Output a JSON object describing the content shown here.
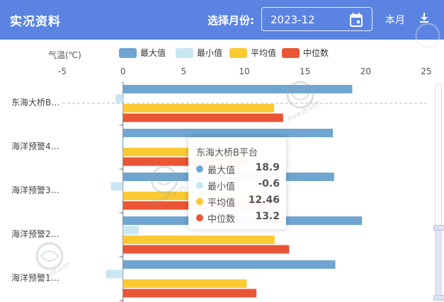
{
  "header": {
    "title": "实况资料",
    "month_label": "选择月份:",
    "month_value": "2023-12",
    "view_button": "本月"
  },
  "icons": {
    "calendar": "calendar-icon",
    "download": "download-icon"
  },
  "watermark_text": "ReadEarth",
  "chart_data": {
    "type": "bar",
    "orientation": "horizontal",
    "ylabel": "气温(℃)",
    "xlim": [
      -5,
      25
    ],
    "ticks": [
      -5,
      0,
      5,
      10,
      15,
      20,
      25
    ],
    "categories": [
      "东海大桥B…",
      "海洋预警4…",
      "海洋预警3…",
      "海洋预警2…",
      "海洋预警1…"
    ],
    "series": [
      {
        "name": "最大值",
        "color": "#6fa5d0",
        "values": [
          18.9,
          17.3,
          17.4,
          19.7,
          17.5
        ]
      },
      {
        "name": "最小值",
        "color": "#c8e7f3",
        "values": [
          -0.6,
          -0.1,
          -1.0,
          1.3,
          -1.4
        ]
      },
      {
        "name": "平均值",
        "color": "#fbc932",
        "values": [
          12.46,
          10.5,
          11.8,
          12.5,
          10.2
        ]
      },
      {
        "name": "中位数",
        "color": "#ea5535",
        "values": [
          13.2,
          10.4,
          12.5,
          13.7,
          11.0
        ]
      }
    ],
    "grid": false,
    "legend_position": "top-center",
    "tooltip": {
      "title": "东海大桥B平台",
      "rows": [
        {
          "name": "最大值",
          "value": "18.9",
          "color": "#6fa5d0"
        },
        {
          "name": "最小值",
          "value": "-0.6",
          "color": "#c8e7f3"
        },
        {
          "name": "平均值",
          "value": "12.46",
          "color": "#fbc932"
        },
        {
          "name": "中位数",
          "value": "13.2",
          "color": "#ea5535"
        }
      ]
    }
  }
}
